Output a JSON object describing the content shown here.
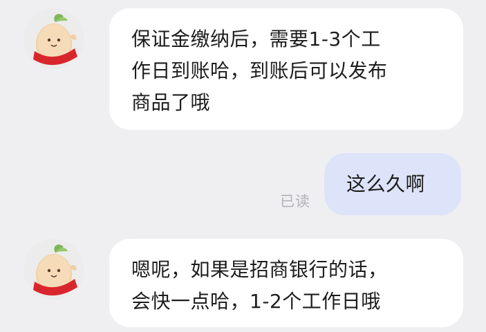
{
  "messages": [
    {
      "direction": "incoming",
      "lines": [
        "保证金缴纳后，需要1-3个工",
        "作日到账哈，到账后可以发布",
        "商品了哦"
      ]
    },
    {
      "direction": "outgoing",
      "lines": [
        "这么久啊"
      ],
      "status": "已读"
    },
    {
      "direction": "incoming",
      "lines": [
        "嗯呢，如果是招商银行的话，",
        "会快一点哈，1-2个工作日哦"
      ]
    }
  ],
  "colors": {
    "background": "#efeff2",
    "incoming_bubble": "#ffffff",
    "outgoing_bubble": "#dde3f8",
    "read_status": "#b3b3b8"
  },
  "icons": {
    "agent_avatar": "sweet-potato-mascot-icon"
  }
}
